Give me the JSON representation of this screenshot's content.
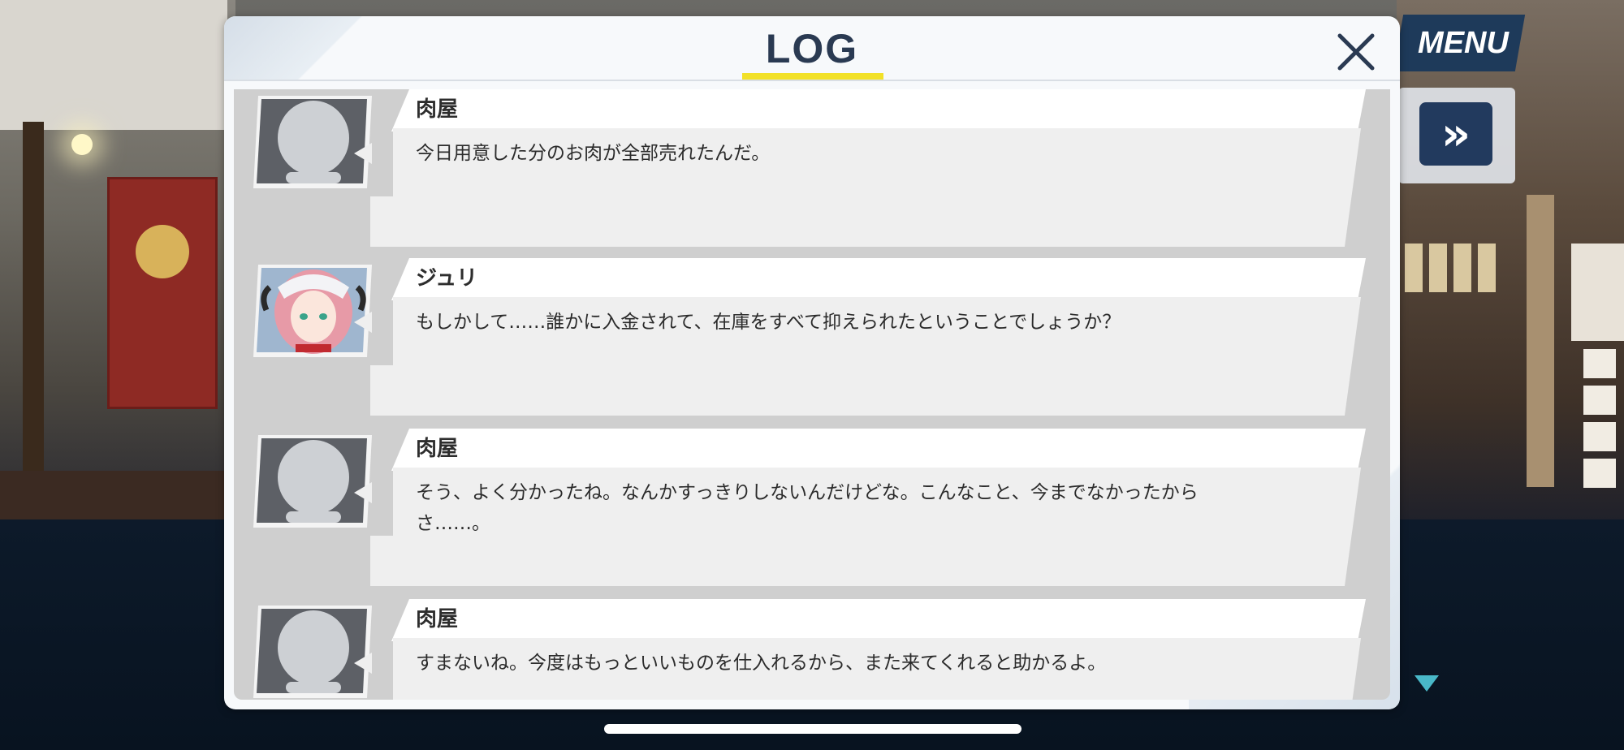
{
  "hud": {
    "menu_label": "MENU",
    "skip_icon": "»"
  },
  "log": {
    "title": "LOG",
    "close_icon": "close-icon",
    "entries": [
      {
        "speaker": "肉屋",
        "avatar": "silhouette",
        "text": "今日用意した分のお肉が全部売れたんだ。"
      },
      {
        "speaker": "ジュリ",
        "avatar": "character-portrait",
        "text": "もしかして……誰かに入金されて、在庫をすべて抑えられたということでしょうか？"
      },
      {
        "speaker": "肉屋",
        "avatar": "silhouette",
        "text_line1": "そう、よく分かったね。なんかすっきりしないんだけどな。こんなこと、今までなかったから",
        "text_line2": "さ……。"
      },
      {
        "speaker": "肉屋",
        "avatar": "silhouette",
        "text": "すまないね。今度はもっといいものを仕入れるから、また来てくれると助かるよ。"
      }
    ]
  },
  "colors": {
    "title": "#2a3a52",
    "underline": "#f2e128",
    "hud_navy": "#223a5e",
    "accent_teal": "#49b8c8"
  }
}
